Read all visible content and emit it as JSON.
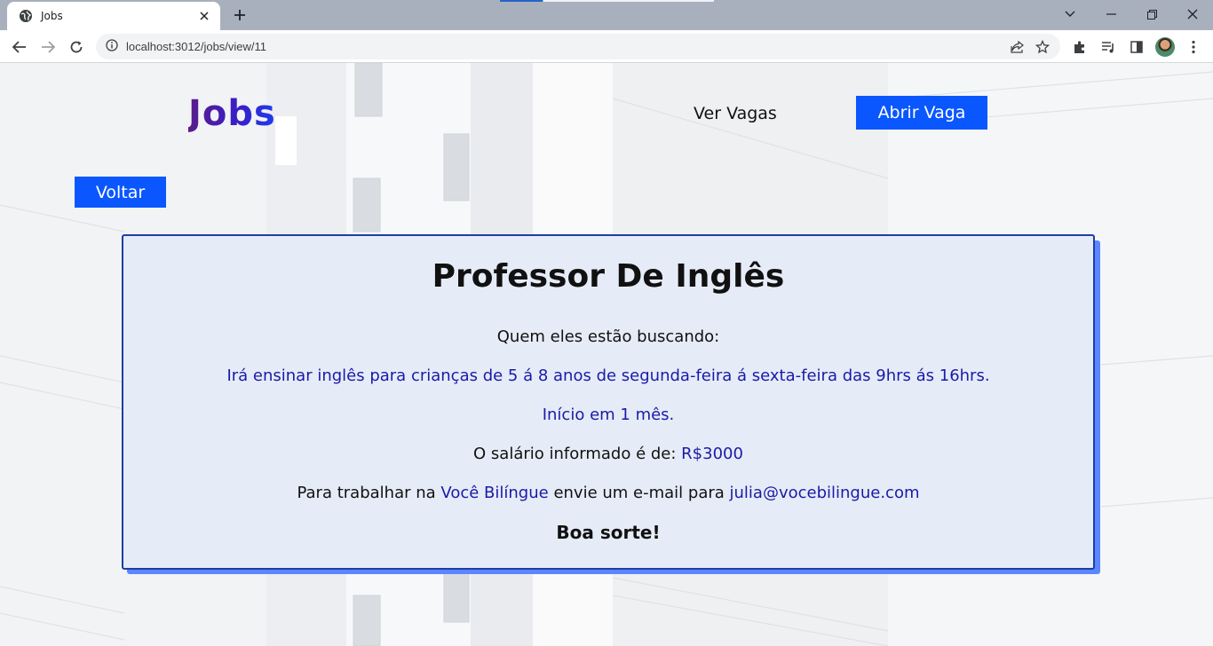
{
  "browser": {
    "tab_title": "Jobs",
    "url": "localhost:3012/jobs/view/11"
  },
  "header": {
    "logo": "Jobs",
    "nav_view_jobs": "Ver Vagas",
    "nav_open_job": "Abrir Vaga"
  },
  "back_button": "Voltar",
  "job": {
    "title": "Professor De Inglês",
    "seeking_label": "Quem eles estão buscando:",
    "description": "Irá ensinar inglês para crianças de 5 á 8 anos de segunda-feira á sexta-feira das 9hrs ás 16hrs. Início em 1 mês.",
    "salary_label": "O salário informado é de:",
    "salary_value": "R$3000",
    "contact_prefix": "Para trabalhar na",
    "company": "Você Bilíngue",
    "contact_middle": "envie um e-mail para",
    "email": "julia@vocebilingue.com",
    "good_luck": "Boa sorte!"
  },
  "colors": {
    "accent_button": "#0a57ff",
    "card_border": "#1d3fa6",
    "card_bg": "#e6ecf7",
    "highlight_text": "#1a1aa8"
  }
}
